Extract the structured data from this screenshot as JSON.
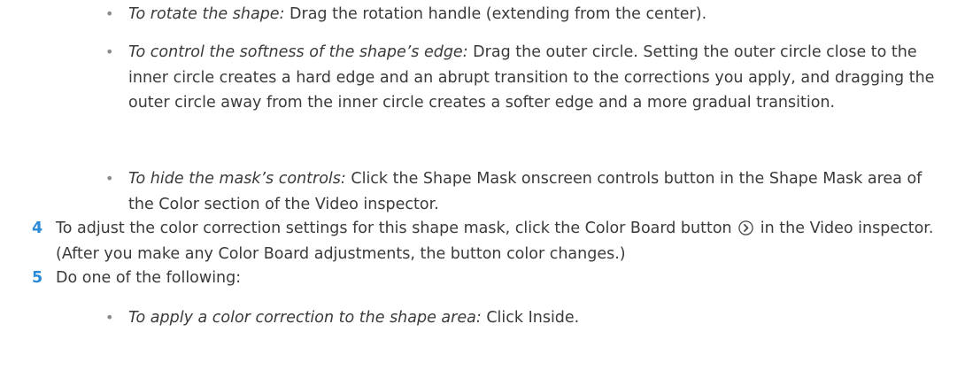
{
  "bullets_top": [
    {
      "lead": "To rotate the shape:",
      "text": " Drag the rotation handle (extending from the center)."
    },
    {
      "lead": "To control the softness of the shape’s edge:",
      "text": " Drag the outer circle. Setting the outer circle close to the inner circle creates a hard edge and an abrupt transition to the corrections you apply, and dragging the outer circle away from the inner circle creates a softer edge and a more gradual transition."
    },
    {
      "lead": "To hide the mask’s controls:",
      "text": " Click the Shape Mask onscreen controls button in the Shape Mask area of the Color section of the Video inspector."
    }
  ],
  "steps": [
    {
      "num": "4",
      "text_before": "To adjust the color correction settings for this shape mask, click the Color Board button ",
      "icon": "chevron-right-circle-icon",
      "text_after": " in the Video inspector. (After you make any Color Board adjustments, the button color changes.)"
    },
    {
      "num": "5",
      "text": "Do one of the following:"
    }
  ],
  "bullets_bottom": [
    {
      "lead": "To apply a color correction to the shape area:",
      "text": " Click Inside."
    }
  ],
  "bullet_glyph": "•",
  "colors": {
    "text": "#3a3a3a",
    "step_number": "#2a8ad8",
    "bullet": "#8a8a8a"
  }
}
